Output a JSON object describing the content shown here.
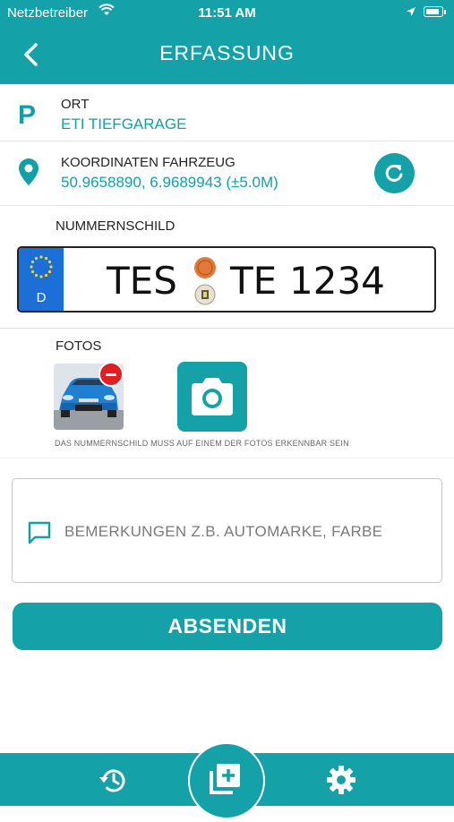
{
  "status_bar": {
    "carrier": "Netzbetreiber",
    "time": "11:51 AM"
  },
  "nav": {
    "title": "ERFASSUNG"
  },
  "location": {
    "label": "ORT",
    "value": "ETI TIEFGARAGE",
    "icon_text": "P"
  },
  "coordinates": {
    "label": "KOORDINATEN FAHRZEUG",
    "value": "50.9658890, 6.9689943 (±5.0M)"
  },
  "plate": {
    "label": "NUMMERNSCHILD",
    "country": "D",
    "city": "TES",
    "letters": "TE",
    "numbers": "1234"
  },
  "photos": {
    "label": "FOTOS",
    "hint": "DAS NUMMERNSCHILD MUSS AUF EINEM DER FOTOS ERKENNBAR SEIN"
  },
  "remarks": {
    "placeholder": "BEMERKUNGEN Z.B. AUTOMARKE, FARBE"
  },
  "submit": {
    "label": "ABSENDEN"
  },
  "colors": {
    "accent": "#14a1a7",
    "delete": "#e02020",
    "eu_blue": "#1b6fd6"
  },
  "icons": {
    "tab_left": "history-icon",
    "tab_center": "add-entry-icon",
    "tab_right": "gear-icon"
  }
}
